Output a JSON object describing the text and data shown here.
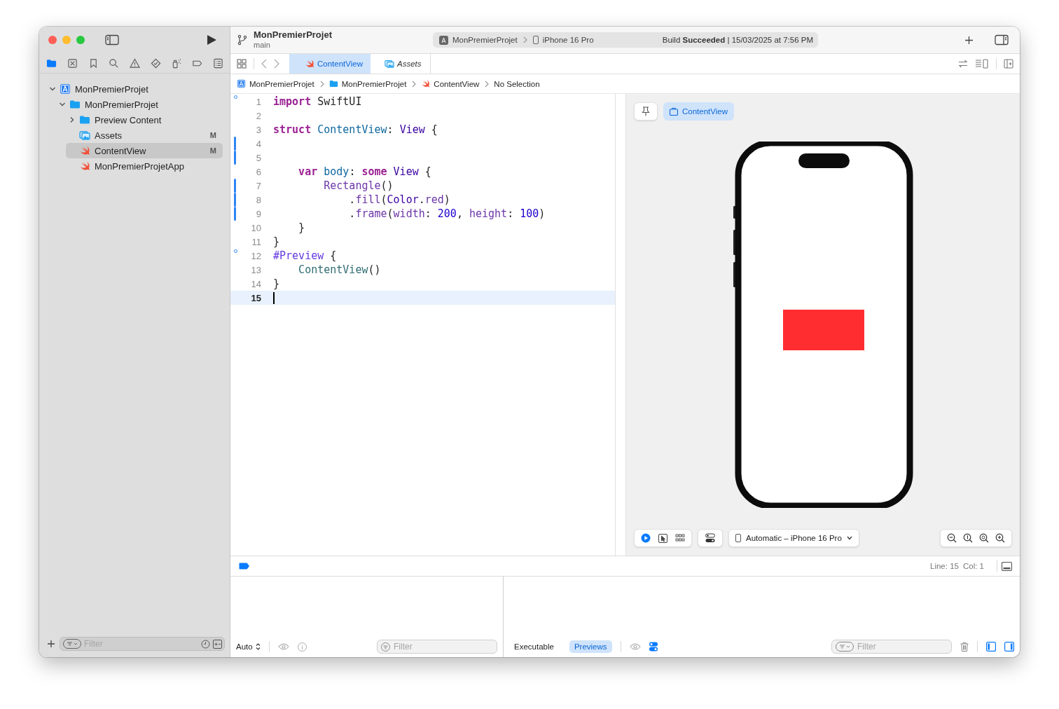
{
  "toolbar": {
    "project": "MonPremierProjet",
    "branch": "main",
    "scheme": {
      "project": "MonPremierProjet",
      "device": "iPhone 16 Pro"
    },
    "status": "Build **Succeeded** | 15/03/2025 at 7:56 PM"
  },
  "navigator_tabs": [
    {
      "kind": "folder",
      "selected": true
    },
    {
      "kind": "x-square",
      "selected": false
    },
    {
      "kind": "bookmark",
      "selected": false
    },
    {
      "kind": "search",
      "selected": false
    },
    {
      "kind": "warning",
      "selected": false
    },
    {
      "kind": "diamond-check",
      "selected": false
    },
    {
      "kind": "spray",
      "selected": false
    },
    {
      "kind": "tag",
      "selected": false
    },
    {
      "kind": "list",
      "selected": false
    }
  ],
  "tree": [
    {
      "label": "MonPremierProjet",
      "kind": "project",
      "expanded": true,
      "selected": false,
      "children": [
        {
          "label": "MonPremierProjet",
          "kind": "folder",
          "expanded": true,
          "selected": false,
          "children": [
            {
              "label": "Preview Content",
              "kind": "folder",
              "expanded": false,
              "selected": false
            },
            {
              "label": "Assets",
              "kind": "assets",
              "status": "M",
              "selected": false
            },
            {
              "label": "ContentView",
              "kind": "swift",
              "status": "M",
              "selected": true
            },
            {
              "label": "MonPremierProjetApp",
              "kind": "swift",
              "selected": false
            }
          ]
        }
      ]
    }
  ],
  "sidebar_filter": {
    "placeholder": "Filter"
  },
  "tabs": [
    {
      "label": "ContentView",
      "kind": "swift",
      "selected": true,
      "temporary": false
    },
    {
      "label": "Assets",
      "kind": "assets",
      "selected": false,
      "temporary": true
    }
  ],
  "breadcrumbs": [
    {
      "label": "MonPremierProjet",
      "kind": "project"
    },
    {
      "label": "MonPremierProjet",
      "kind": "folder"
    },
    {
      "label": "ContentView",
      "kind": "swift"
    },
    {
      "label": "No Selection",
      "kind": "none"
    }
  ],
  "code": {
    "lines": [
      {
        "number": "1",
        "kind": "marker",
        "current": false,
        "tokens": [
          {
            "t": "import",
            "kind": "keyword"
          },
          {
            "t": " SwiftUI",
            "kind": "plain"
          }
        ]
      },
      {
        "number": "2",
        "kind": "plain",
        "current": false
      },
      {
        "number": "3",
        "kind": "plain",
        "current": false,
        "tokens": [
          {
            "t": "struct",
            "kind": "keyword"
          },
          {
            "t": " ContentView",
            "kind": "declaration"
          },
          {
            "t": ": ",
            "kind": "plain"
          },
          {
            "t": "View",
            "kind": "type"
          },
          {
            "t": " {",
            "kind": "plain"
          }
        ]
      },
      {
        "number": "4",
        "kind": "changed",
        "current": false
      },
      {
        "number": "5",
        "kind": "changed",
        "current": false
      },
      {
        "number": "6",
        "kind": "plain",
        "current": false,
        "tokens": [
          {
            "t": "    var",
            "kind": "keyword"
          },
          {
            "t": " body",
            "kind": "declaration"
          },
          {
            "t": ": ",
            "kind": "plain"
          },
          {
            "t": "some",
            "kind": "keyword"
          },
          {
            "t": " View",
            "kind": "type"
          },
          {
            "t": " {",
            "kind": "plain"
          }
        ]
      },
      {
        "number": "7",
        "kind": "changed",
        "current": false,
        "tokens": [
          {
            "t": "        Rectangle",
            "kind": "member"
          },
          {
            "t": "()",
            "kind": "plain"
          }
        ]
      },
      {
        "number": "8",
        "kind": "changed",
        "current": false,
        "tokens": [
          {
            "t": "            .",
            "kind": "plain"
          },
          {
            "t": "fill",
            "kind": "member"
          },
          {
            "t": "(",
            "kind": "plain"
          },
          {
            "t": "Color",
            "kind": "type"
          },
          {
            "t": ".",
            "kind": "plain"
          },
          {
            "t": "red",
            "kind": "member"
          },
          {
            "t": ")",
            "kind": "plain"
          }
        ]
      },
      {
        "number": "9",
        "kind": "changed",
        "current": false,
        "tokens": [
          {
            "t": "            .",
            "kind": "plain"
          },
          {
            "t": "frame",
            "kind": "member"
          },
          {
            "t": "(",
            "kind": "plain"
          },
          {
            "t": "width",
            "kind": "member"
          },
          {
            "t": ": ",
            "kind": "plain"
          },
          {
            "t": "200",
            "kind": "number"
          },
          {
            "t": ", ",
            "kind": "plain"
          },
          {
            "t": "height",
            "kind": "member"
          },
          {
            "t": ": ",
            "kind": "plain"
          },
          {
            "t": "100",
            "kind": "number"
          },
          {
            "t": ")",
            "kind": "plain"
          }
        ]
      },
      {
        "number": "10",
        "kind": "plain",
        "current": false,
        "tokens": [
          {
            "t": "    }",
            "kind": "plain"
          }
        ]
      },
      {
        "number": "11",
        "kind": "plain",
        "current": false,
        "tokens": [
          {
            "t": "}",
            "kind": "plain"
          }
        ]
      },
      {
        "number": "12",
        "kind": "marker",
        "current": false,
        "tokens": [
          {
            "t": "#Preview",
            "kind": "macro"
          },
          {
            "t": " {",
            "kind": "plain"
          }
        ]
      },
      {
        "number": "13",
        "kind": "plain",
        "current": false,
        "tokens": [
          {
            "t": "    ContentView",
            "kind": "reference"
          },
          {
            "t": "()",
            "kind": "plain"
          }
        ]
      },
      {
        "number": "14",
        "kind": "plain",
        "current": false,
        "tokens": [
          {
            "t": "}",
            "kind": "plain"
          }
        ]
      },
      {
        "number": "15",
        "kind": "plain",
        "current": true
      }
    ]
  },
  "preview": {
    "title": "ContentView",
    "title_selected": true,
    "modes": [
      {
        "kind": "live",
        "selected": true
      },
      {
        "kind": "select",
        "selected": false
      },
      {
        "kind": "grid",
        "selected": false
      }
    ],
    "device": "Automatic – iPhone 16 Pro"
  },
  "debug_bar": {
    "line": "Line: 15",
    "column": "Col: 1"
  },
  "variables": {
    "scope": "Auto",
    "filter_placeholder": "Filter"
  },
  "console": {
    "tabs": [
      {
        "label": "Executable",
        "selected": false
      },
      {
        "label": "Previews",
        "selected": true
      }
    ],
    "filter_placeholder": "Filter"
  }
}
